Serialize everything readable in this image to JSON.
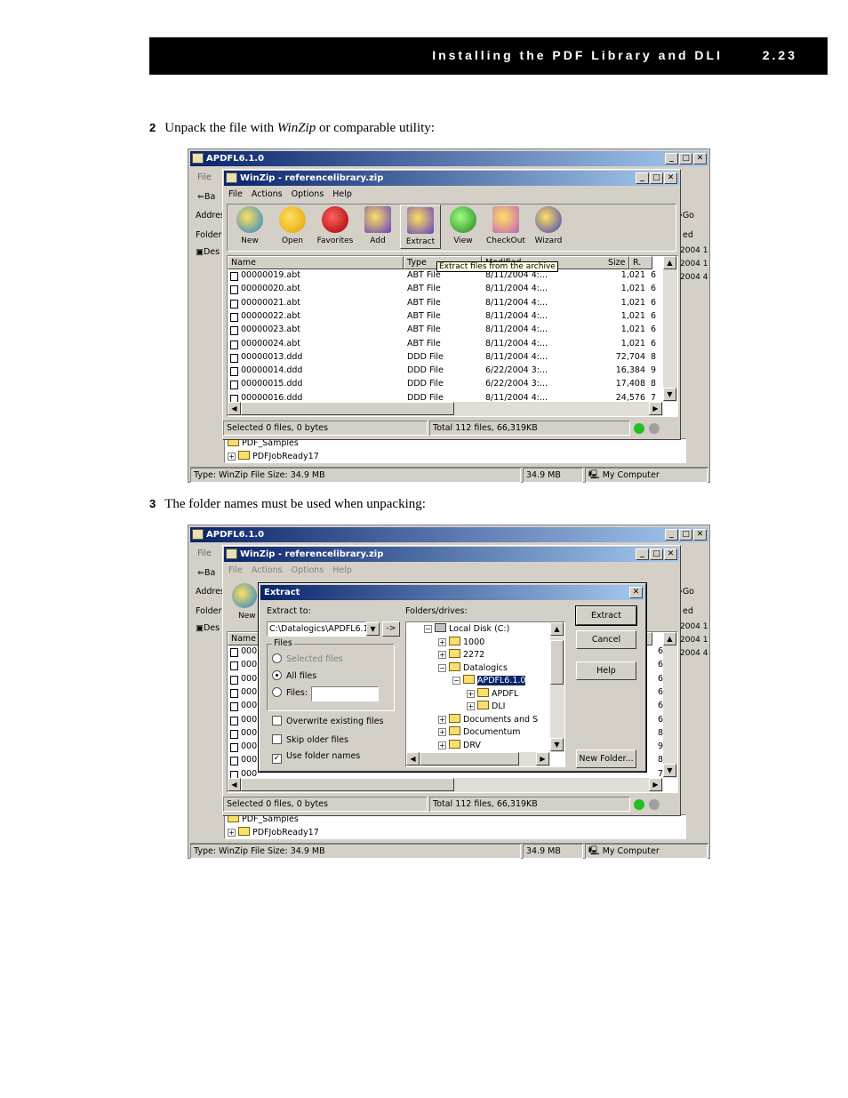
{
  "header": {
    "title": "Installing the PDF Library and DLI",
    "page": "2.23"
  },
  "steps": [
    {
      "num": "2",
      "pre": "Unpack the file with ",
      "em": "WinZip",
      "post": " or comparable utility:"
    },
    {
      "num": "3",
      "text": "The folder names must be used when unpacking:"
    }
  ],
  "explorer": {
    "title": "APDFL6.1.0",
    "menu_file": "File",
    "back": "Ba",
    "address": "Addres",
    "folder": "Folder",
    "go": "Go",
    "modified_stub": "ed",
    "tree_desktop": "Des",
    "dates": [
      "2004 1",
      "2004 1",
      "2004 4"
    ],
    "tree_items": [
      "PDF_Samples",
      "PDFJobReady17"
    ],
    "status": {
      "type": "Type: WinZip File Size: 34.9 MB",
      "size": "34.9 MB",
      "zone": "My Computer"
    }
  },
  "winzip": {
    "title": "WinZip - referencelibrary.zip",
    "menu": [
      "File",
      "Actions",
      "Options",
      "Help"
    ],
    "toolbar": [
      "New",
      "Open",
      "Favorites",
      "Add",
      "Extract",
      "View",
      "CheckOut",
      "Wizard"
    ],
    "columns": [
      "Name",
      "Type",
      "Modified",
      "Size",
      "R."
    ],
    "tooltip": "Extract files from the archive",
    "files": [
      [
        "00000019.abt",
        "ABT File",
        "8/11/2004 4:...",
        "1,021",
        "6"
      ],
      [
        "00000020.abt",
        "ABT File",
        "8/11/2004 4:...",
        "1,021",
        "6"
      ],
      [
        "00000021.abt",
        "ABT File",
        "8/11/2004 4:...",
        "1,021",
        "6"
      ],
      [
        "00000022.abt",
        "ABT File",
        "8/11/2004 4:...",
        "1,021",
        "6"
      ],
      [
        "00000023.abt",
        "ABT File",
        "8/11/2004 4:...",
        "1,021",
        "6"
      ],
      [
        "00000024.abt",
        "ABT File",
        "8/11/2004 4:...",
        "1,021",
        "6"
      ],
      [
        "00000013.ddd",
        "DDD File",
        "8/11/2004 4:...",
        "72,704",
        "8"
      ],
      [
        "00000014.ddd",
        "DDD File",
        "6/22/2004 3:...",
        "16,384",
        "9"
      ],
      [
        "00000015.ddd",
        "DDD File",
        "6/22/2004 3:...",
        "17,408",
        "8"
      ],
      [
        "00000016.ddd",
        "DDD File",
        "8/11/2004 4:...",
        "24,576",
        "7"
      ]
    ],
    "status_left": "Selected 0 files, 0 bytes",
    "status_right": "Total 112 files, 66,319KB"
  },
  "extract_dialog": {
    "title": "Extract",
    "extract_to_label": "Extract to:",
    "extract_to_value": "C:\\Datalogics\\APDFL6.1",
    "arrow_btn": "->",
    "folders_label": "Folders/drives:",
    "files_group": "Files",
    "radio_selected": "Selected files",
    "radio_all": "All files",
    "radio_files": "Files:",
    "chk_overwrite": "Overwrite existing files",
    "chk_skip": "Skip older files",
    "chk_folder": "Use folder names",
    "buttons": [
      "Extract",
      "Cancel",
      "Help"
    ],
    "new_folder": "New Folder...",
    "tree": [
      "Local Disk (C:)",
      "1000",
      "2272",
      "Datalogics",
      "APDFL6.1.0",
      "APDFL",
      "DLI",
      "Documents and S",
      "Documentum",
      "DRV"
    ],
    "partial_name": "000",
    "partial_rows": [
      "6",
      "6",
      "6",
      "6",
      "6",
      "6",
      "8",
      "9",
      "8",
      "7"
    ],
    "name_col": "Name",
    "new_stub": "New",
    "last_row": "000",
    "col_r": "R.",
    "col_6": "6"
  }
}
